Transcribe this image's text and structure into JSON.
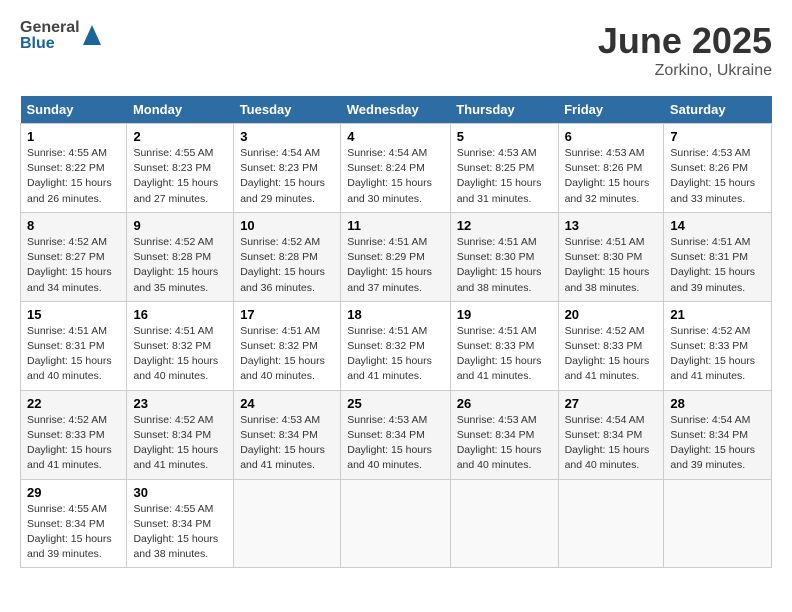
{
  "header": {
    "logo_general": "General",
    "logo_blue": "Blue",
    "month_title": "June 2025",
    "location": "Zorkino, Ukraine"
  },
  "calendar": {
    "days_of_week": [
      "Sunday",
      "Monday",
      "Tuesday",
      "Wednesday",
      "Thursday",
      "Friday",
      "Saturday"
    ],
    "weeks": [
      [
        {
          "day": 1,
          "sunrise": "4:55 AM",
          "sunset": "8:22 PM",
          "daylight": "15 hours and 26 minutes."
        },
        {
          "day": 2,
          "sunrise": "4:55 AM",
          "sunset": "8:23 PM",
          "daylight": "15 hours and 27 minutes."
        },
        {
          "day": 3,
          "sunrise": "4:54 AM",
          "sunset": "8:23 PM",
          "daylight": "15 hours and 29 minutes."
        },
        {
          "day": 4,
          "sunrise": "4:54 AM",
          "sunset": "8:24 PM",
          "daylight": "15 hours and 30 minutes."
        },
        {
          "day": 5,
          "sunrise": "4:53 AM",
          "sunset": "8:25 PM",
          "daylight": "15 hours and 31 minutes."
        },
        {
          "day": 6,
          "sunrise": "4:53 AM",
          "sunset": "8:26 PM",
          "daylight": "15 hours and 32 minutes."
        },
        {
          "day": 7,
          "sunrise": "4:53 AM",
          "sunset": "8:26 PM",
          "daylight": "15 hours and 33 minutes."
        }
      ],
      [
        {
          "day": 8,
          "sunrise": "4:52 AM",
          "sunset": "8:27 PM",
          "daylight": "15 hours and 34 minutes."
        },
        {
          "day": 9,
          "sunrise": "4:52 AM",
          "sunset": "8:28 PM",
          "daylight": "15 hours and 35 minutes."
        },
        {
          "day": 10,
          "sunrise": "4:52 AM",
          "sunset": "8:28 PM",
          "daylight": "15 hours and 36 minutes."
        },
        {
          "day": 11,
          "sunrise": "4:51 AM",
          "sunset": "8:29 PM",
          "daylight": "15 hours and 37 minutes."
        },
        {
          "day": 12,
          "sunrise": "4:51 AM",
          "sunset": "8:30 PM",
          "daylight": "15 hours and 38 minutes."
        },
        {
          "day": 13,
          "sunrise": "4:51 AM",
          "sunset": "8:30 PM",
          "daylight": "15 hours and 38 minutes."
        },
        {
          "day": 14,
          "sunrise": "4:51 AM",
          "sunset": "8:31 PM",
          "daylight": "15 hours and 39 minutes."
        }
      ],
      [
        {
          "day": 15,
          "sunrise": "4:51 AM",
          "sunset": "8:31 PM",
          "daylight": "15 hours and 40 minutes."
        },
        {
          "day": 16,
          "sunrise": "4:51 AM",
          "sunset": "8:32 PM",
          "daylight": "15 hours and 40 minutes."
        },
        {
          "day": 17,
          "sunrise": "4:51 AM",
          "sunset": "8:32 PM",
          "daylight": "15 hours and 40 minutes."
        },
        {
          "day": 18,
          "sunrise": "4:51 AM",
          "sunset": "8:32 PM",
          "daylight": "15 hours and 41 minutes."
        },
        {
          "day": 19,
          "sunrise": "4:51 AM",
          "sunset": "8:33 PM",
          "daylight": "15 hours and 41 minutes."
        },
        {
          "day": 20,
          "sunrise": "4:52 AM",
          "sunset": "8:33 PM",
          "daylight": "15 hours and 41 minutes."
        },
        {
          "day": 21,
          "sunrise": "4:52 AM",
          "sunset": "8:33 PM",
          "daylight": "15 hours and 41 minutes."
        }
      ],
      [
        {
          "day": 22,
          "sunrise": "4:52 AM",
          "sunset": "8:33 PM",
          "daylight": "15 hours and 41 minutes."
        },
        {
          "day": 23,
          "sunrise": "4:52 AM",
          "sunset": "8:34 PM",
          "daylight": "15 hours and 41 minutes."
        },
        {
          "day": 24,
          "sunrise": "4:53 AM",
          "sunset": "8:34 PM",
          "daylight": "15 hours and 41 minutes."
        },
        {
          "day": 25,
          "sunrise": "4:53 AM",
          "sunset": "8:34 PM",
          "daylight": "15 hours and 40 minutes."
        },
        {
          "day": 26,
          "sunrise": "4:53 AM",
          "sunset": "8:34 PM",
          "daylight": "15 hours and 40 minutes."
        },
        {
          "day": 27,
          "sunrise": "4:54 AM",
          "sunset": "8:34 PM",
          "daylight": "15 hours and 40 minutes."
        },
        {
          "day": 28,
          "sunrise": "4:54 AM",
          "sunset": "8:34 PM",
          "daylight": "15 hours and 39 minutes."
        }
      ],
      [
        {
          "day": 29,
          "sunrise": "4:55 AM",
          "sunset": "8:34 PM",
          "daylight": "15 hours and 39 minutes."
        },
        {
          "day": 30,
          "sunrise": "4:55 AM",
          "sunset": "8:34 PM",
          "daylight": "15 hours and 38 minutes."
        },
        null,
        null,
        null,
        null,
        null
      ]
    ]
  }
}
